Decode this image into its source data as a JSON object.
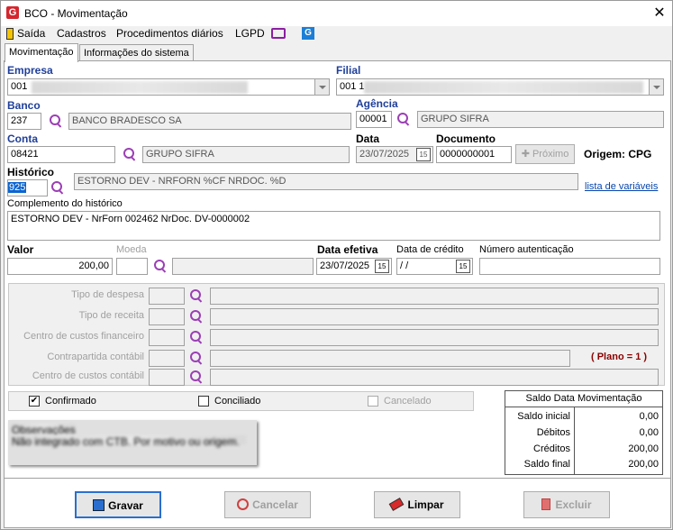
{
  "window": {
    "title": "BCO - Movimentação",
    "logo_letter": "G"
  },
  "menu": {
    "items": [
      "Saída",
      "Cadastros",
      "Procedimentos diários",
      "LGPD"
    ]
  },
  "tabs": [
    "Movimentação",
    "Informações do sistema"
  ],
  "empresa": {
    "label": "Empresa",
    "value": "001"
  },
  "filial": {
    "label": "Filial",
    "value": "001 1"
  },
  "banco": {
    "label": "Banco",
    "code": "237",
    "name": "BANCO BRADESCO SA"
  },
  "agencia": {
    "label": "Agência",
    "code": "00001",
    "name": "GRUPO SIFRA"
  },
  "conta": {
    "label": "Conta",
    "code": "08421",
    "name": "GRUPO SIFRA"
  },
  "data": {
    "label": "Data",
    "value": "23/07/2025"
  },
  "documento": {
    "label": "Documento",
    "value": "0000000001",
    "proximo": "Próximo"
  },
  "origem": "Origem: CPG",
  "historico": {
    "label": "Histórico",
    "code": "925",
    "text": "ESTORNO DEV - NRFORN %CF NRDOC. %D",
    "link": "lista de variáveis"
  },
  "complemento": {
    "label": "Complemento do histórico",
    "value": "ESTORNO DEV - NrForn 002462 NrDoc. DV-0000002"
  },
  "valor": {
    "label": "Valor",
    "value": "200,00"
  },
  "moeda": {
    "label": "Moeda"
  },
  "data_efetiva": {
    "label": "Data efetiva",
    "value": "23/07/2025"
  },
  "data_credito": {
    "label": "Data de crédito",
    "value": " / /"
  },
  "numero_autenticacao": {
    "label": "Número autenticação"
  },
  "classificacao": {
    "tipo_despesa": "Tipo de despesa",
    "tipo_receita": "Tipo de receita",
    "centro_custos_financeiro": "Centro de custos financeiro",
    "contrapartida_contabil": "Contrapartida contábil",
    "centro_custos_contabil": "Centro de custos contábil",
    "plano": "( Plano = 1 )"
  },
  "status": {
    "confirmado": "Confirmado",
    "conciliado": "Conciliado",
    "cancelado": "Cancelado",
    "check_mark": "✔"
  },
  "observacoes": {
    "label": "Observações",
    "value": "Não integrado com CTB. Por motivo ou origem."
  },
  "saldo": {
    "title": "Saldo Data Movimentação",
    "rows": [
      {
        "label": "Saldo inicial",
        "value": "0,00"
      },
      {
        "label": "Débitos",
        "value": "0,00"
      },
      {
        "label": "Créditos",
        "value": "200,00"
      },
      {
        "label": "Saldo final",
        "value": "200,00"
      }
    ]
  },
  "buttons": {
    "gravar": "Gravar",
    "cancelar": "Cancelar",
    "limpar": "Limpar",
    "excluir": "Excluir"
  },
  "colors": {
    "accent_blue": "#2a6fcf",
    "purple_icon": "#9b3fb5",
    "plano_red": "#8b0000"
  }
}
